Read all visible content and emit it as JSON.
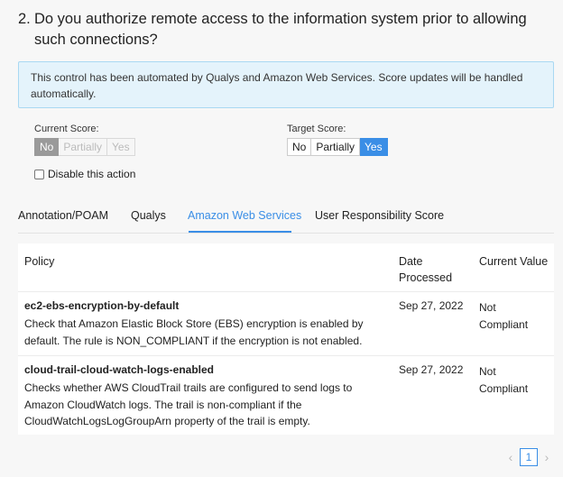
{
  "question": {
    "number": "2.",
    "text": "Do you authorize remote access to the information system prior to allowing such connections?"
  },
  "notice": "This control has been automated by Qualys and Amazon Web Services. Score updates will be handled automatically.",
  "current_score": {
    "label": "Current Score:",
    "options": [
      "No",
      "Partially",
      "Yes"
    ],
    "selected": "No"
  },
  "target_score": {
    "label": "Target Score:",
    "options": [
      "No",
      "Partially",
      "Yes"
    ],
    "selected": "Yes"
  },
  "disable_action_label": "Disable this action",
  "tabs": [
    "Annotation/POAM",
    "Qualys",
    "Amazon Web Services",
    "User Responsibility Score"
  ],
  "active_tab": "Amazon Web Services",
  "table": {
    "headers": {
      "policy": "Policy",
      "date_line1": "Date",
      "date_line2": "Processed",
      "value": "Current Value"
    },
    "rows": [
      {
        "name": "ec2-ebs-encryption-by-default",
        "description": "Check that Amazon Elastic Block Store (EBS) encryption is enabled by default. The rule is NON_COMPLIANT if the encryption is not enabled.",
        "date": "Sep 27, 2022",
        "value_line1": "Not",
        "value_line2": "Compliant"
      },
      {
        "name": "cloud-trail-cloud-watch-logs-enabled",
        "description": "Checks whether AWS CloudTrail trails are configured to send logs to Amazon CloudWatch logs. The trail is non-compliant if the CloudWatchLogsLogGroupArn property of the trail is empty.",
        "date": "Sep 27, 2022",
        "value_line1": "Not",
        "value_line2": "Compliant"
      }
    ]
  },
  "pagination": {
    "prev_icon": "chevron-left-icon",
    "current_page": "1",
    "next_icon": "chevron-right-icon"
  },
  "colors": {
    "accent": "#3a8ee6",
    "notice_bg": "#e4f3fb",
    "disabled_selected": "#9a9a9a"
  }
}
